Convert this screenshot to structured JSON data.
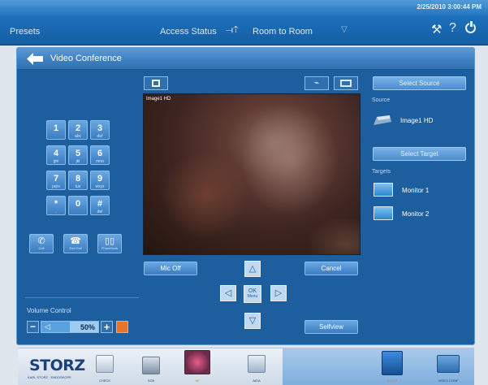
{
  "topbar": {
    "datetime": "2/25/2010 3:00:44 PM",
    "presets_label": "Presets",
    "access_label": "Access Status",
    "route_label": "Room to Room",
    "help_glyph": "?"
  },
  "page": {
    "title": "Video Conference"
  },
  "dialpad": {
    "keys": [
      {
        "digit": "1",
        "sub": ""
      },
      {
        "digit": "2",
        "sub": "abc"
      },
      {
        "digit": "3",
        "sub": "def"
      },
      {
        "digit": "4",
        "sub": "ghi"
      },
      {
        "digit": "5",
        "sub": "jkl"
      },
      {
        "digit": "6",
        "sub": "mno"
      },
      {
        "digit": "7",
        "sub": "pqrs"
      },
      {
        "digit": "8",
        "sub": "tuv"
      },
      {
        "digit": "9",
        "sub": "wxyz"
      },
      {
        "digit": "*",
        "sub": "."
      },
      {
        "digit": "0",
        "sub": ""
      },
      {
        "digit": "#",
        "sub": "del"
      }
    ],
    "call_label": "Call",
    "end_label": "End Call",
    "phonebook_label": "Phonebook"
  },
  "volume": {
    "label": "Volume Control",
    "percent_text": "50%",
    "level": 0.5
  },
  "video": {
    "source_label": "Image1 HD"
  },
  "controls": {
    "mic_off_label": "Mic Off",
    "cancel_label": "Cancel",
    "selfview_label": "Selfview",
    "ok_label": "OK",
    "menu_label": "Menu"
  },
  "sidebar": {
    "select_source_label": "Select Source",
    "source_heading": "Source",
    "source_name": "Image1 HD",
    "select_target_label": "Select Target",
    "targets_heading": "Targets",
    "targets": [
      "Monitor 1",
      "Monitor 2"
    ]
  },
  "dock": {
    "brand": "STORZ",
    "brand_sub": "KARL STORZ · ENDOSKOPE",
    "items": [
      "CHECK",
      "SCB",
      "AV",
      "AIDA"
    ],
    "right_items": [
      "ROOM",
      "VIDEO CONF"
    ]
  },
  "colors": {
    "accent": "#1b6fbb",
    "panel": "#1d5f9e",
    "mute_orange": "#e8732a"
  }
}
